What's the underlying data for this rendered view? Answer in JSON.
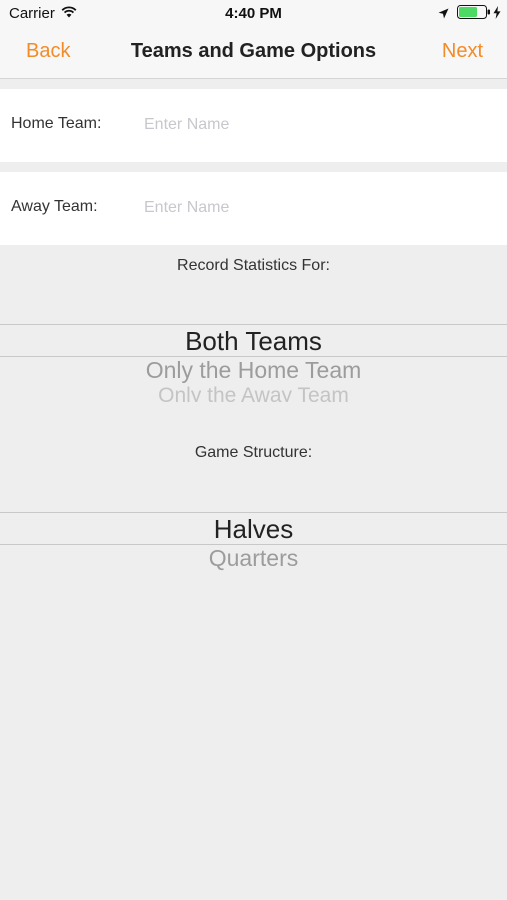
{
  "status_bar": {
    "carrier": "Carrier",
    "time": "4:40 PM",
    "icons": [
      "wifi-icon",
      "location-arrow-icon",
      "battery-icon",
      "charging-bolt-icon"
    ],
    "battery_color": "#4CD964"
  },
  "nav": {
    "back_label": "Back",
    "title": "Teams and Game Options",
    "next_label": "Next",
    "accent_color": "#F28C28"
  },
  "home_team": {
    "label": "Home Team:",
    "placeholder": "Enter Name",
    "value": ""
  },
  "away_team": {
    "label": "Away Team:",
    "placeholder": "Enter Name",
    "value": ""
  },
  "stats_picker": {
    "label": "Record Statistics For:",
    "options": [
      "Both Teams",
      "Only the Home Team",
      "Only the Away Team"
    ],
    "selected": "Both Teams"
  },
  "structure_picker": {
    "label": "Game Structure:",
    "options": [
      "Halves",
      "Quarters"
    ],
    "selected": "Halves"
  }
}
